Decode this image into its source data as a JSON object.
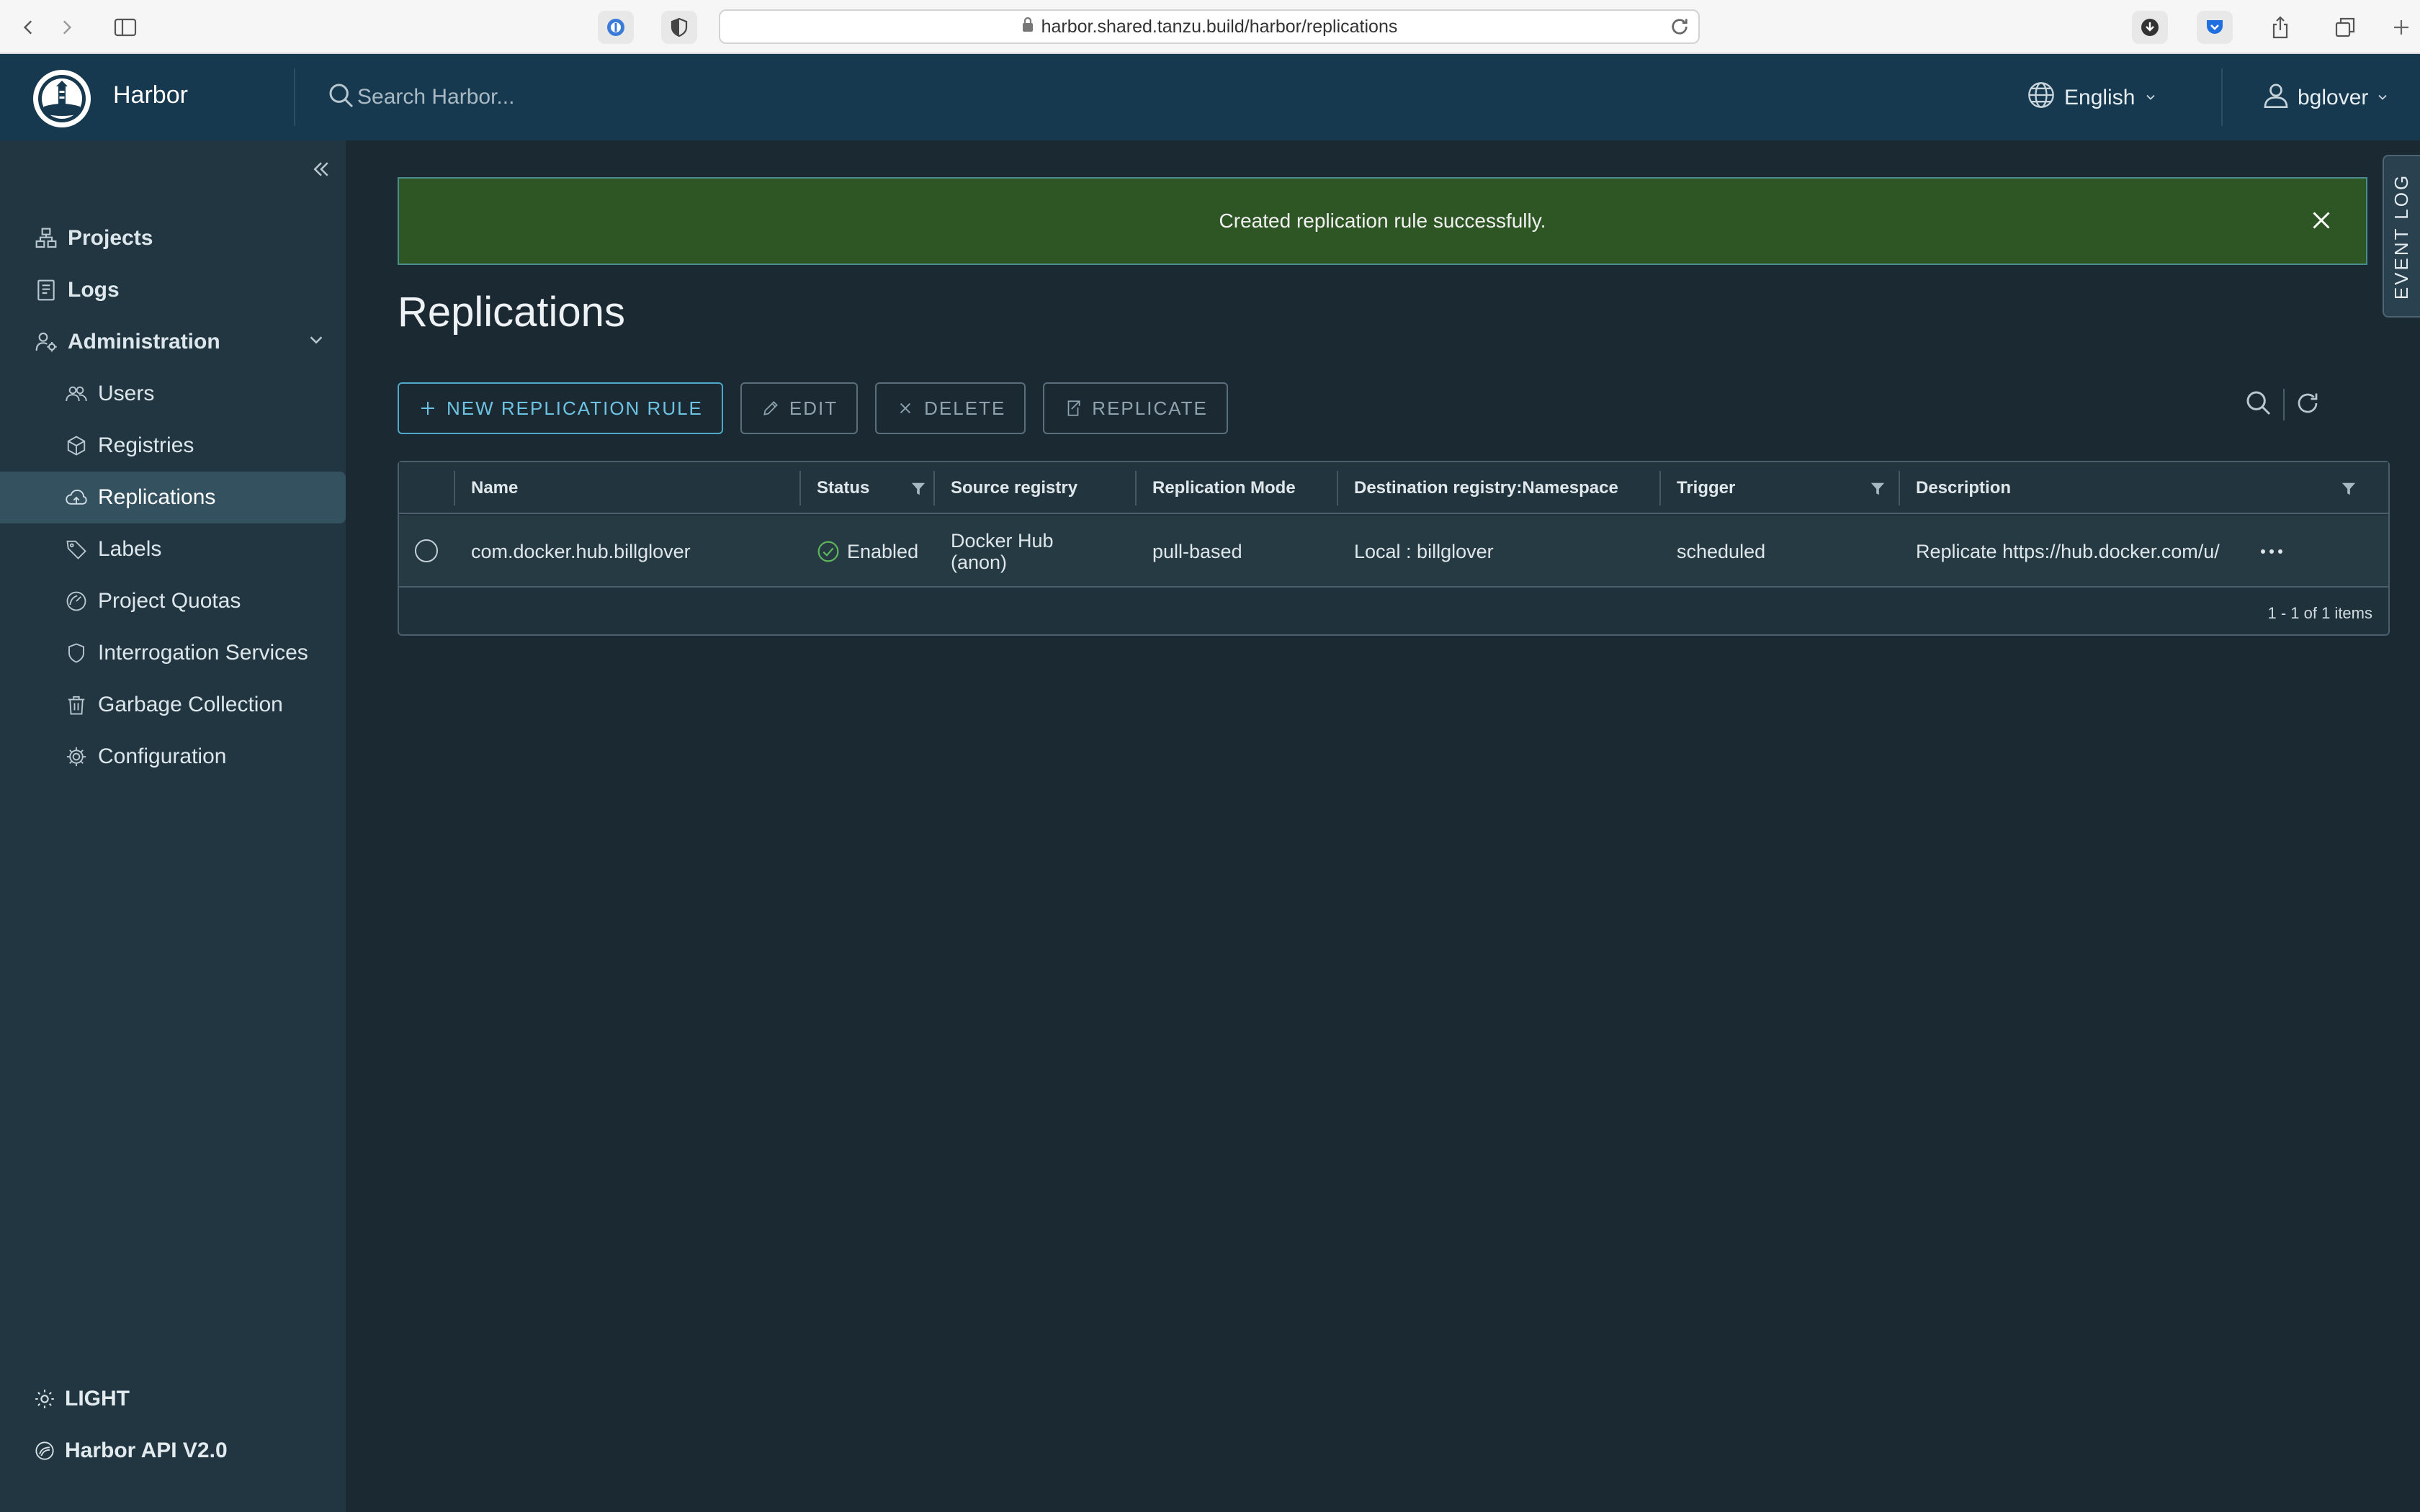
{
  "browser": {
    "url": "harbor.shared.tanzu.build/harbor/replications"
  },
  "header": {
    "brand": "Harbor",
    "search_placeholder": "Search Harbor...",
    "language": "English",
    "username": "bglover"
  },
  "sidebar": {
    "items": [
      {
        "label": "Projects",
        "icon": "projects-icon"
      },
      {
        "label": "Logs",
        "icon": "logs-icon"
      },
      {
        "label": "Administration",
        "icon": "administration-icon"
      }
    ],
    "admin_items": [
      {
        "label": "Users",
        "icon": "users-icon"
      },
      {
        "label": "Registries",
        "icon": "registries-icon"
      },
      {
        "label": "Replications",
        "icon": "replications-icon",
        "active": true
      },
      {
        "label": "Labels",
        "icon": "labels-icon"
      },
      {
        "label": "Project Quotas",
        "icon": "quotas-icon"
      },
      {
        "label": "Interrogation Services",
        "icon": "shield-icon"
      },
      {
        "label": "Garbage Collection",
        "icon": "trash-icon"
      },
      {
        "label": "Configuration",
        "icon": "gear-icon"
      }
    ],
    "footer": {
      "theme_label": "LIGHT",
      "api_label": "Harbor API V2.0"
    }
  },
  "alert": {
    "message": "Created replication rule successfully."
  },
  "event_log": {
    "label": "EVENT LOG"
  },
  "page": {
    "title": "Replications"
  },
  "toolbar": {
    "new_rule": "NEW REPLICATION RULE",
    "edit": "EDIT",
    "delete": "DELETE",
    "replicate": "REPLICATE"
  },
  "table": {
    "columns": [
      "Name",
      "Status",
      "Source registry",
      "Replication Mode",
      "Destination registry:Namespace",
      "Trigger",
      "Description"
    ],
    "rows": [
      {
        "name": "com.docker.hub.billglover",
        "status": "Enabled",
        "source_registry": "Docker Hub (anon)",
        "mode": "pull-based",
        "destination": "Local : billglover",
        "trigger": "scheduled",
        "description": "Replicate https://hub.docker.com/u/"
      }
    ],
    "footer": "1 - 1 of 1 items"
  },
  "colors": {
    "header_bg": "#17394f",
    "sidebar_bg": "#213641",
    "main_bg": "#1b2a32",
    "alert_bg": "#2e5524",
    "primary_accent": "#6dc3e4",
    "status_ok": "#5fb85a"
  }
}
